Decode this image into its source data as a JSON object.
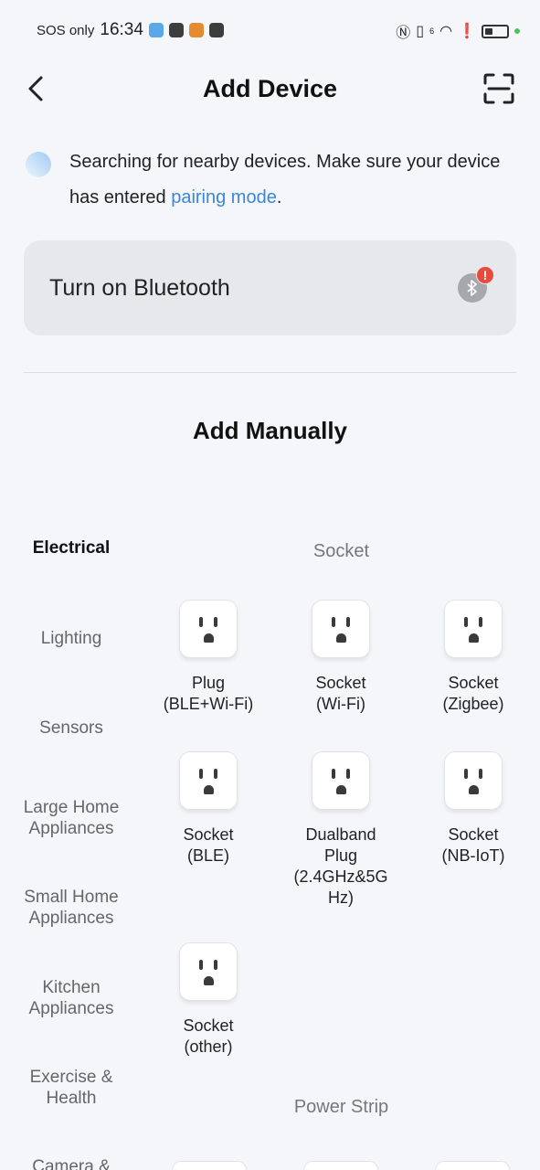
{
  "status_bar": {
    "carrier": "SOS only",
    "time": "16:34",
    "app_icon_colors": [
      "#5aa8e8",
      "#3d3d3d",
      "#e58a2f",
      "#3d3d3d"
    ],
    "network_label": "6"
  },
  "header": {
    "title": "Add Device"
  },
  "search_notice": {
    "text_before": "Searching for nearby devices. Make sure your device has entered ",
    "link": "pairing mode",
    "text_after": "."
  },
  "bluetooth_card": {
    "label": "Turn on Bluetooth",
    "badge": "!"
  },
  "add_manually": {
    "title": "Add Manually"
  },
  "categories": [
    {
      "label": "Electrical",
      "active": true
    },
    {
      "label": "Lighting",
      "active": false
    },
    {
      "label": "Sensors",
      "active": false
    },
    {
      "label": "Large Home Appliances",
      "active": false
    },
    {
      "label": "Small Home Appliances",
      "active": false
    },
    {
      "label": "Kitchen Appliances",
      "active": false
    },
    {
      "label": "Exercise & Health",
      "active": false
    },
    {
      "label": "Camera &",
      "active": false
    }
  ],
  "sections": [
    {
      "title": "Socket",
      "devices": [
        {
          "line1": "Plug",
          "line2": "(BLE+Wi-Fi)"
        },
        {
          "line1": "Socket",
          "line2": "(Wi-Fi)"
        },
        {
          "line1": "Socket",
          "line2": "(Zigbee)"
        },
        {
          "line1": "Socket",
          "line2": "(BLE)"
        },
        {
          "line1": "Dualband",
          "line2": "Plug",
          "line3": "(2.4GHz&5G",
          "line4": "Hz)"
        },
        {
          "line1": "Socket",
          "line2": "(NB-IoT)"
        },
        {
          "line1": "Socket",
          "line2": "(other)"
        }
      ]
    },
    {
      "title": "Power Strip",
      "devices": []
    }
  ],
  "colors": {
    "background": "#f5f6fa",
    "accent_link": "#3b86d9",
    "card": "#e7e8ec",
    "badge_red": "#e84a3c"
  }
}
